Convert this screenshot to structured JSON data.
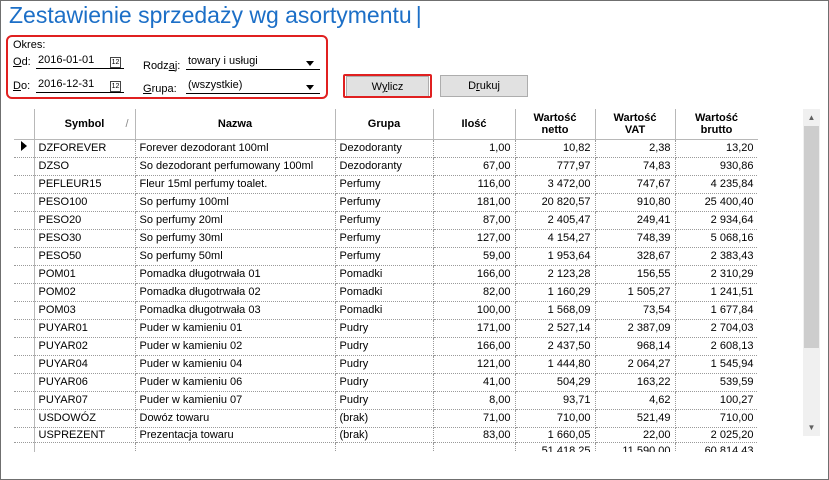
{
  "title": "Zestawienie sprzedaży wg asortymentu",
  "period": {
    "group_label": "Okres:",
    "from_label_u": "O",
    "from_label_rest": "d:",
    "from_value": "2016-01-01",
    "to_label_u": "D",
    "to_label_rest": "o:",
    "to_value": "2016-12-31"
  },
  "filters": {
    "kind_label_pre": "Rodz",
    "kind_label_u": "a",
    "kind_label_post": "j:",
    "kind_value": "towary i usługi",
    "group_label_u": "G",
    "group_label_rest": "rupa:",
    "group_value": "(wszystkie)"
  },
  "buttons": {
    "calculate_pre": "W",
    "calculate_u": "y",
    "calculate_post": "licz",
    "print_pre": "D",
    "print_u": "r",
    "print_post": "ukuj"
  },
  "table": {
    "headers": {
      "symbol": "Symbol",
      "sort_glyph": "/",
      "name": "Nazwa",
      "group": "Grupa",
      "qty": "Ilość",
      "net_1": "Wartość",
      "net_2": "netto",
      "vat_1": "Wartość",
      "vat_2": "VAT",
      "gross_1": "Wartość",
      "gross_2": "brutto"
    },
    "rows": [
      {
        "symbol": "DZFOREVER",
        "name": "Forever dezodorant 100ml",
        "group": "Dezodoranty",
        "qty": "1,00",
        "net": "10,82",
        "vat": "2,38",
        "gross": "13,20"
      },
      {
        "symbol": "DZSO",
        "name": "So dezodorant perfumowany 100ml",
        "group": "Dezodoranty",
        "qty": "67,00",
        "net": "777,97",
        "vat": "74,83",
        "gross": "930,86"
      },
      {
        "symbol": "PEFLEUR15",
        "name": "Fleur 15ml perfumy toalet.",
        "group": "Perfumy",
        "qty": "116,00",
        "net": "3 472,00",
        "vat": "747,67",
        "gross": "4 235,84"
      },
      {
        "symbol": "PESO100",
        "name": "So perfumy 100ml",
        "group": "Perfumy",
        "qty": "181,00",
        "net": "20 820,57",
        "vat": "910,80",
        "gross": "25 400,40"
      },
      {
        "symbol": "PESO20",
        "name": "So perfumy 20ml",
        "group": "Perfumy",
        "qty": "87,00",
        "net": "2 405,47",
        "vat": "249,41",
        "gross": "2 934,64"
      },
      {
        "symbol": "PESO30",
        "name": "So perfumy 30ml",
        "group": "Perfumy",
        "qty": "127,00",
        "net": "4 154,27",
        "vat": "748,39",
        "gross": "5 068,16"
      },
      {
        "symbol": "PESO50",
        "name": "So perfumy 50ml",
        "group": "Perfumy",
        "qty": "59,00",
        "net": "1 953,64",
        "vat": "328,67",
        "gross": "2 383,43"
      },
      {
        "symbol": "POM01",
        "name": "Pomadka długotrwała 01",
        "group": "Pomadki",
        "qty": "166,00",
        "net": "2 123,28",
        "vat": "156,55",
        "gross": "2 310,29"
      },
      {
        "symbol": "POM02",
        "name": "Pomadka długotrwała 02",
        "group": "Pomadki",
        "qty": "82,00",
        "net": "1 160,29",
        "vat": "1 505,27",
        "gross": "1 241,51"
      },
      {
        "symbol": "POM03",
        "name": "Pomadka długotrwała 03",
        "group": "Pomadki",
        "qty": "100,00",
        "net": "1 568,09",
        "vat": "73,54",
        "gross": "1 677,84"
      },
      {
        "symbol": "PUYAR01",
        "name": "Puder w kamieniu 01",
        "group": "Pudry",
        "qty": "171,00",
        "net": "2 527,14",
        "vat": "2 387,09",
        "gross": "2 704,03"
      },
      {
        "symbol": "PUYAR02",
        "name": "Puder w kamieniu 02",
        "group": "Pudry",
        "qty": "166,00",
        "net": "2 437,50",
        "vat": "968,14",
        "gross": "2 608,13"
      },
      {
        "symbol": "PUYAR04",
        "name": "Puder w kamieniu 04",
        "group": "Pudry",
        "qty": "121,00",
        "net": "1 444,80",
        "vat": "2 064,27",
        "gross": "1 545,94"
      },
      {
        "symbol": "PUYAR06",
        "name": "Puder w kamieniu 06",
        "group": "Pudry",
        "qty": "41,00",
        "net": "504,29",
        "vat": "163,22",
        "gross": "539,59"
      },
      {
        "symbol": "PUYAR07",
        "name": "Puder w kamieniu 07",
        "group": "Pudry",
        "qty": "8,00",
        "net": "93,71",
        "vat": "4,62",
        "gross": "100,27"
      },
      {
        "symbol": "USDOWÓZ",
        "name": "Dowóz towaru",
        "group": "(brak)",
        "qty": "71,00",
        "net": "710,00",
        "vat": "521,49",
        "gross": "710,00"
      },
      {
        "symbol": "USPREZENT",
        "name": "Prezentacja towaru",
        "group": "(brak)",
        "qty": "83,00",
        "net": "1 660,05",
        "vat": "22,00",
        "gross": "2 025,20"
      }
    ],
    "totals": {
      "net": "51 418,25",
      "vat": "11 590,00",
      "gross": "60 814,43"
    }
  },
  "icons": {
    "calendar": "calendar-icon",
    "dropdown": "chevron-down-icon",
    "row_pointer": "row-pointer-icon",
    "scroll_up": "scroll-up-icon",
    "scroll_down": "scroll-down-icon"
  },
  "colors": {
    "title": "#1c6fc7",
    "highlight": "#e02020",
    "button_bg": "#e1e1e1"
  }
}
